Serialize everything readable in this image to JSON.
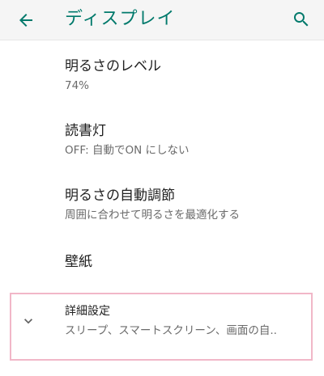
{
  "app_bar": {
    "title": "ディスプレイ",
    "back_icon": "arrow-back-icon",
    "search_icon": "search-icon",
    "accent_color": "#00796b"
  },
  "settings": [
    {
      "label": "明るさのレベル",
      "summary": "74%"
    },
    {
      "label": "読書灯",
      "summary": "OFF: 自動でON にしない"
    },
    {
      "label": "明るさの自動調節",
      "summary": "周囲に合わせて明るさを最適化する"
    },
    {
      "label": "壁紙",
      "summary": ""
    }
  ],
  "advanced": {
    "label": "詳細設定",
    "summary": "スリープ、スマートスクリーン、画面の自..",
    "icon": "chevron-down-icon",
    "highlight_color": "#f1b7c8"
  }
}
